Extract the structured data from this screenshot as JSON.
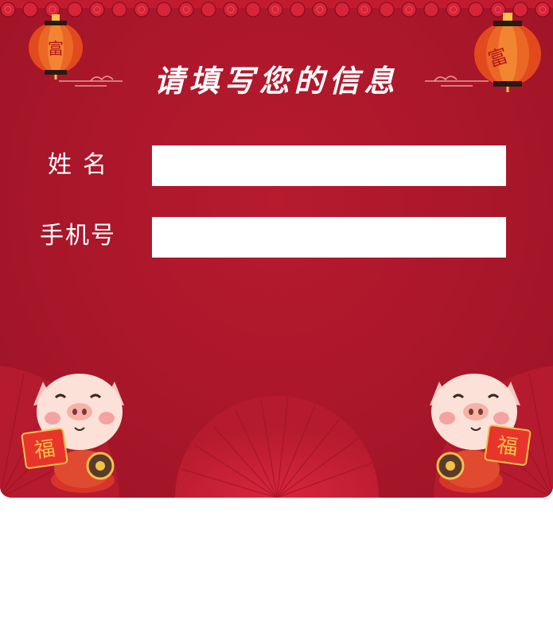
{
  "form": {
    "title": "请填写您的信息",
    "name_label": "姓名",
    "name_value": "",
    "phone_label": "手机号",
    "phone_value": ""
  },
  "decor": {
    "lantern_char": "富",
    "fu_char": "福",
    "lantern_icon": "red-lantern-icon",
    "pig_icon": "cartoon-pig-icon",
    "fan_icon": "paper-fan-icon",
    "cloud_icon": "auspicious-cloud-icon"
  },
  "colors": {
    "background": "#a8162a",
    "accent_gold": "#f4c24a",
    "field_bg": "#ffffff",
    "text": "#ffffff"
  }
}
